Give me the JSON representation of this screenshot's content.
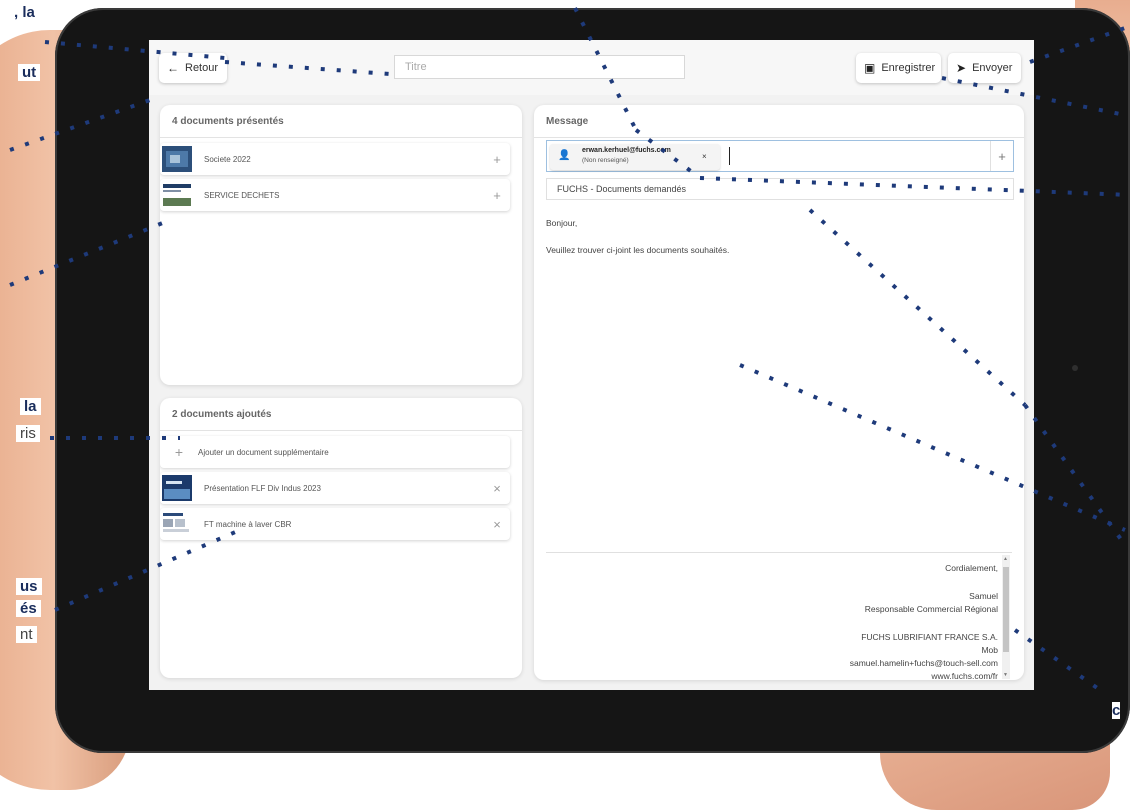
{
  "callouts": {
    "left": [
      {
        "text": ", la",
        "bold": true
      },
      {
        "text": "ut",
        "bold": true
      },
      {
        "text": "la",
        "bold": true
      },
      {
        "text": "ris",
        "bold": false
      },
      {
        "text": "us",
        "bold": true
      },
      {
        "text": "és",
        "bold": true
      },
      {
        "text": "nt",
        "bold": false
      }
    ],
    "right": [
      {
        "text": "c",
        "bold": true
      }
    ]
  },
  "toolbar": {
    "back_icon": "arrow-left-icon",
    "back_label": "Retour",
    "title_placeholder": "Titre",
    "save_icon": "save-icon",
    "save_label": "Enregistrer",
    "send_icon": "send-icon",
    "send_label": "Envoyer"
  },
  "presented": {
    "header": "4 documents présentés",
    "items": [
      {
        "label": "Societe 2022",
        "action": "+"
      },
      {
        "label": "SERVICE DECHETS",
        "action": "+"
      }
    ]
  },
  "added": {
    "header": "2 documents ajoutés",
    "add_label": "Ajouter un document supplémentaire",
    "add_icon": "+",
    "items": [
      {
        "label": "Présentation FLF Div Indus 2023",
        "action": "×"
      },
      {
        "label": "FT machine à laver CBR",
        "action": "×"
      }
    ]
  },
  "message": {
    "header": "Message",
    "recipient": {
      "email": "erwan.kerhuel@fuchs.com",
      "status": "(Non renseigné)",
      "remove": "×",
      "icon": "user-icon"
    },
    "add_recipient": "+",
    "subject": "FUCHS - Documents demandés",
    "greeting": "Bonjour,",
    "body": "Veuillez trouver ci-joint les documents souhaités.",
    "signature": [
      "Cordialement,",
      "Samuel",
      "Responsable Commercial Régional",
      "FUCHS LUBRIFIANT FRANCE S.A.",
      "Mob",
      "samuel.hamelin+fuchs@touch-sell.com",
      "www.fuchs.com/fr"
    ]
  },
  "colors": {
    "dot_lines": "#1e3a7a",
    "accent_border": "#9ec0e0"
  }
}
